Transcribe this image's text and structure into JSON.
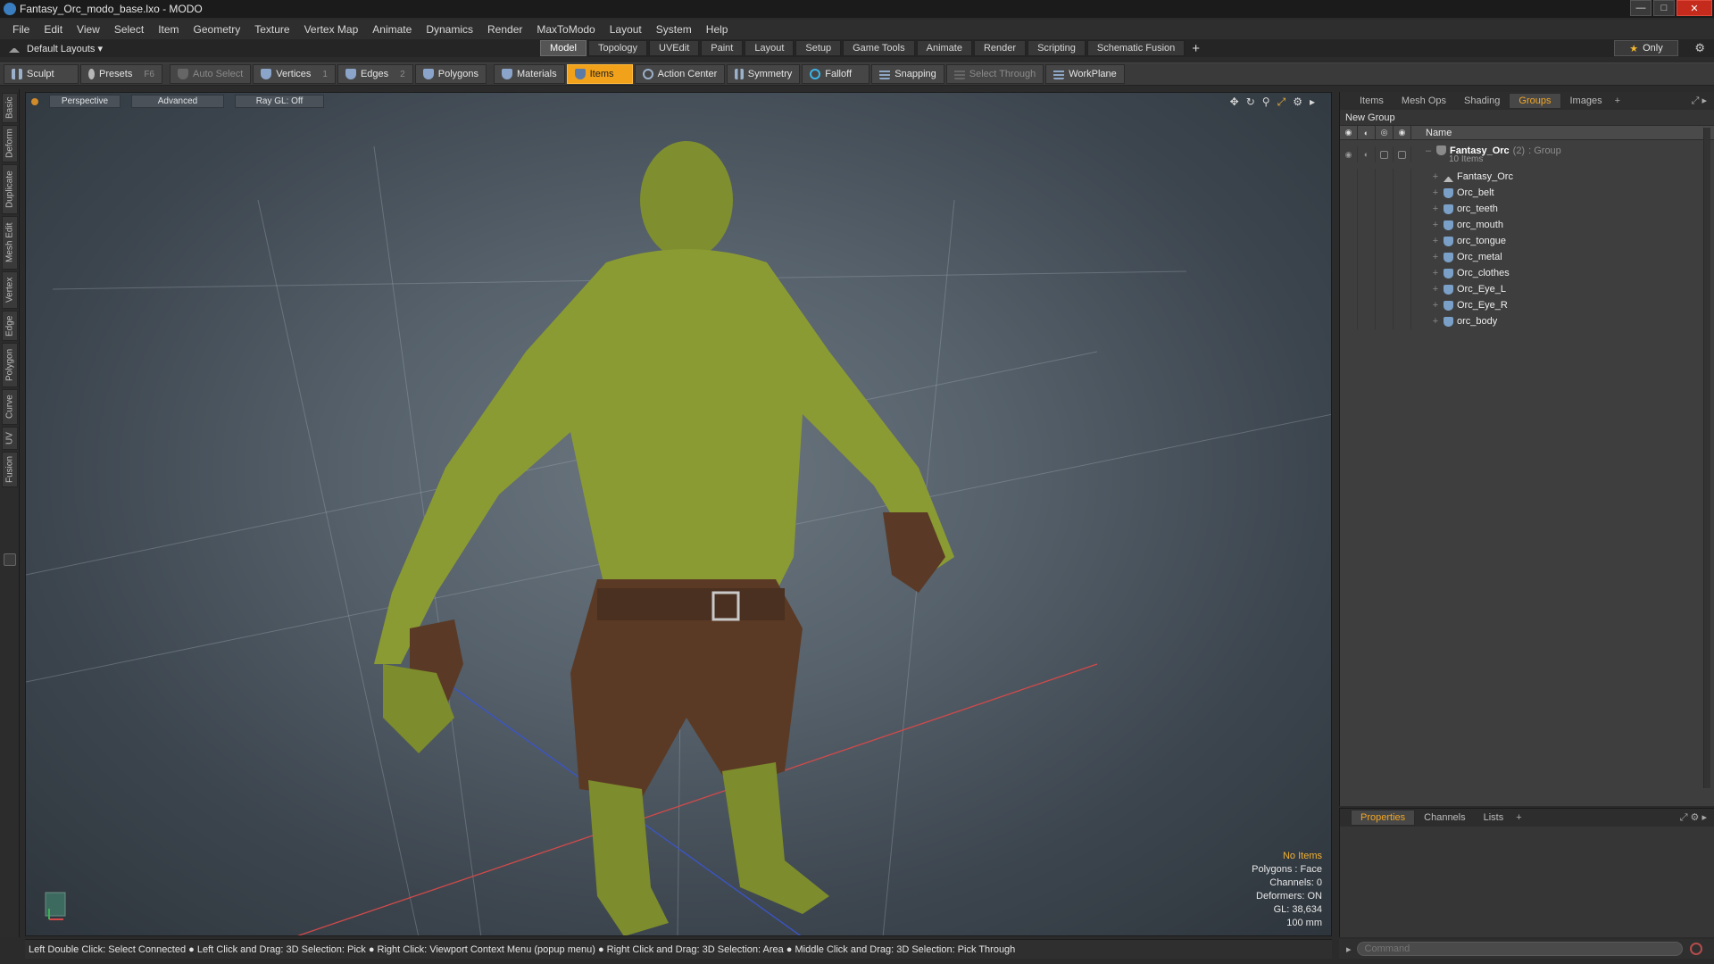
{
  "window": {
    "title": "Fantasy_Orc_modo_base.lxo - MODO"
  },
  "menu": [
    "File",
    "Edit",
    "View",
    "Select",
    "Item",
    "Geometry",
    "Texture",
    "Vertex Map",
    "Animate",
    "Dynamics",
    "Render",
    "MaxToModo",
    "Layout",
    "System",
    "Help"
  ],
  "layouts": {
    "dropdown": "Default Layouts ▾",
    "tabs": [
      "Model",
      "Topology",
      "UVEdit",
      "Paint",
      "Layout",
      "Setup",
      "Game Tools",
      "Animate",
      "Render",
      "Scripting",
      "Schematic Fusion"
    ],
    "active": "Model",
    "only_label": "Only"
  },
  "toolbar": {
    "sculpt": "Sculpt",
    "presets": "Presets",
    "presets_key": "F6",
    "auto_select": "Auto Select",
    "vertices": "Vertices",
    "vertices_key": "1",
    "edges": "Edges",
    "edges_key": "2",
    "polygons": "Polygons",
    "materials": "Materials",
    "items": "Items",
    "action_center": "Action Center",
    "symmetry": "Symmetry",
    "falloff": "Falloff",
    "snapping": "Snapping",
    "select_through": "Select Through",
    "workplane": "WorkPlane"
  },
  "left_tabs": [
    "Basic",
    "Deform",
    "Duplicate",
    "Mesh Edit",
    "Vertex",
    "Edge",
    "Polygon",
    "Curve",
    "UV",
    "Fusion"
  ],
  "viewport": {
    "tabs": [
      "Perspective",
      "Advanced",
      "Ray GL: Off"
    ],
    "stats": {
      "no_items": "No Items",
      "polygons": "Polygons : Face",
      "channels": "Channels: 0",
      "deformers": "Deformers: ON",
      "gl": "GL: 38,634",
      "scale": "100 mm"
    }
  },
  "status_bar": "Left Double Click: Select Connected ● Left Click and Drag: 3D Selection: Pick ● Right Click: Viewport Context Menu (popup menu) ● Right Click and Drag: 3D Selection: Area ● Middle Click and Drag: 3D Selection: Pick Through",
  "right_panel": {
    "tabs": [
      "Items",
      "Mesh Ops",
      "Shading",
      "Groups",
      "Images"
    ],
    "active": "Groups",
    "new_group": "New Group",
    "column": "Name",
    "group": {
      "name": "Fantasy_Orc",
      "count": "(2)",
      "type": ": Group",
      "items_label": "10 Items"
    },
    "items": [
      "Fantasy_Orc",
      "Orc_belt",
      "orc_teeth",
      "orc_mouth",
      "orc_tongue",
      "Orc_metal",
      "Orc_clothes",
      "Orc_Eye_L",
      "Orc_Eye_R",
      "orc_body"
    ]
  },
  "lower_panel": {
    "tabs": [
      "Properties",
      "Channels",
      "Lists"
    ],
    "active": "Properties"
  },
  "command": {
    "placeholder": "Command"
  }
}
